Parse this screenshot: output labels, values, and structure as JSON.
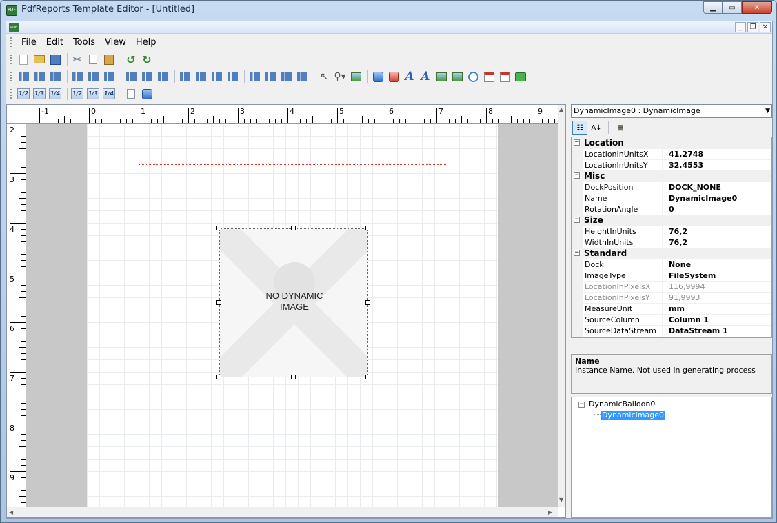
{
  "window": {
    "title": "PdfReports Template Editor - [Untitled]",
    "icon_label": "PDF",
    "controls": [
      "minimize-icon",
      "maximize-icon",
      "close-icon"
    ]
  },
  "menu": {
    "items": [
      "File",
      "Edit",
      "Tools",
      "View",
      "Help"
    ]
  },
  "toolbar": {
    "row1": [
      "new-icon",
      "open-icon",
      "save-icon",
      "cut-icon",
      "copy-icon",
      "paste-icon",
      "undo-icon",
      "redo-icon"
    ],
    "row2": [
      "align-left-icon",
      "align-center-icon",
      "align-right-icon",
      "align-top-icon",
      "align-middle-icon",
      "align-bottom-icon",
      "same-width-icon",
      "same-height-icon",
      "same-size-icon",
      "hspace-equal-icon",
      "hspace-increase-icon",
      "hspace-decrease-icon",
      "hspace-remove-icon",
      "vspace-equal-icon",
      "vspace-increase-icon",
      "vspace-decrease-icon",
      "vspace-remove-icon",
      "pointer-icon",
      "zoom-icon",
      "table-icon",
      "balloon-icon",
      "rounded-box-icon",
      "text-icon",
      "formatted-text-icon",
      "image-icon",
      "dynamic-image-icon",
      "clock-icon",
      "calendar-icon",
      "page-number-icon",
      "barcode-icon"
    ],
    "row3": {
      "fractions_a": [
        "1/2",
        "1/3",
        "1/4"
      ],
      "fractions_b": [
        "1/2",
        "1/3",
        "1/4"
      ],
      "extra": [
        "bring-front-icon",
        "send-back-icon"
      ]
    }
  },
  "ruler": {
    "horizontal": [
      "-1",
      "0",
      "1",
      "2",
      "3",
      "4",
      "5",
      "6",
      "7",
      "8",
      "9"
    ],
    "vertical": [
      "2",
      "3",
      "4",
      "5",
      "6",
      "7",
      "8",
      "9"
    ]
  },
  "canvas": {
    "placeholder_line1": "NO DYNAMIC",
    "placeholder_line2": "IMAGE"
  },
  "properties": {
    "selected_object": "DynamicImage0 : DynamicImage",
    "categories": [
      {
        "name": "Location",
        "rows": [
          {
            "name": "LocationInUnitsX",
            "value": "41,2748"
          },
          {
            "name": "LocationInUnitsY",
            "value": "32,4553"
          }
        ]
      },
      {
        "name": "Misc",
        "rows": [
          {
            "name": "DockPosition",
            "value": "DOCK_NONE"
          },
          {
            "name": "Name",
            "value": "DynamicImage0"
          },
          {
            "name": "RotationAngle",
            "value": "0"
          }
        ]
      },
      {
        "name": "Size",
        "rows": [
          {
            "name": "HeightInUnits",
            "value": "76,2"
          },
          {
            "name": "WidthInUnits",
            "value": "76,2"
          }
        ]
      },
      {
        "name": "Standard",
        "rows": [
          {
            "name": "Dock",
            "value": "None"
          },
          {
            "name": "ImageType",
            "value": "FileSystem"
          },
          {
            "name": "LocationInPixelsX",
            "value": "116,9994",
            "readonly": true
          },
          {
            "name": "LocationInPixelsY",
            "value": "91,9993",
            "readonly": true
          },
          {
            "name": "MeasureUnit",
            "value": "mm"
          },
          {
            "name": "SourceColumn",
            "value": "Column 1"
          },
          {
            "name": "SourceDataStream",
            "value": "DataStream 1"
          }
        ]
      }
    ],
    "help": {
      "title": "Name",
      "description": "Instance Name. Not used in generating process"
    }
  },
  "tree": {
    "root": "DynamicBalloon0",
    "child": "DynamicImage0"
  },
  "colors": {
    "selection": "#3399ff",
    "balloon_border": "#d23a2a",
    "page_margin": "#c8c8c8"
  }
}
